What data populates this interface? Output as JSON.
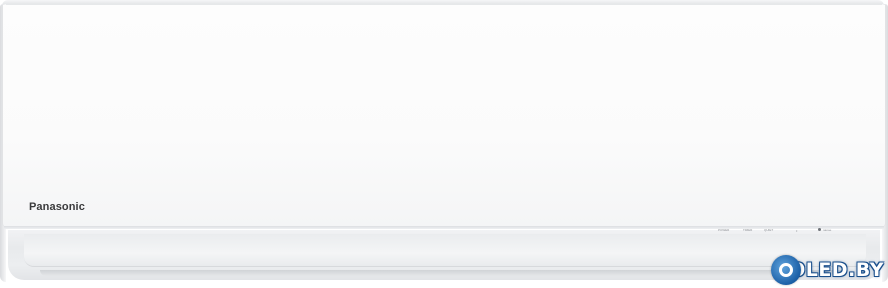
{
  "unit": {
    "brand": "Panasonic",
    "indicators": {
      "power": "POWER",
      "timer": "TIMER",
      "quiet": "QUIET",
      "dot": "•",
      "feature": "nanoe"
    }
  },
  "watermark": {
    "text": "OLED.BY",
    "icon": "o-circle-logo",
    "color": "#1b5fa6"
  },
  "colors": {
    "body": "#fbfbfb",
    "louver": "#e8eaec",
    "logo": "#3a3a3c"
  }
}
